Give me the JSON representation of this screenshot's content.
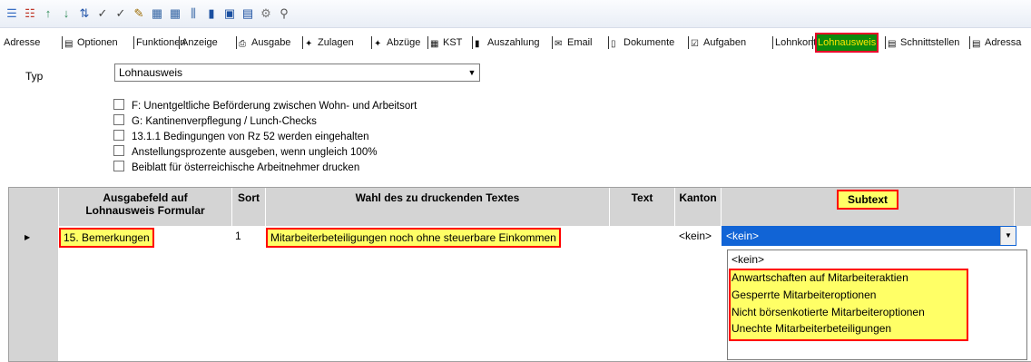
{
  "toolbar": {
    "icons": [
      "tree-expand-icon",
      "tree-collapse-icon",
      "arrow-up-icon",
      "arrow-down-icon",
      "sort-icon",
      "spellcheck-icon",
      "spellcheck-alt-icon",
      "edit-icon",
      "grid-icon",
      "grid-alt-icon",
      "insert-column-icon",
      "chart-icon",
      "save-icon",
      "report-icon",
      "settings-icon",
      "search-icon"
    ],
    "glyphs": [
      "☰",
      "☷",
      "↑",
      "↓",
      "⇅",
      "✓",
      "✓",
      "✎",
      "▦",
      "▦",
      "⫼",
      "▮",
      "▣",
      "▤",
      "⚙",
      "⚲"
    ]
  },
  "tabs": [
    {
      "label": "Adresse",
      "icon": ""
    },
    {
      "label": "Optionen",
      "icon": "▤"
    },
    {
      "label": "Funktionen",
      "icon": ""
    },
    {
      "label": "Anzeige",
      "icon": ""
    },
    {
      "label": "Ausgabe",
      "icon": "⎙"
    },
    {
      "label": "Zulagen",
      "icon": "✦"
    },
    {
      "label": "Abzüge",
      "icon": "✦"
    },
    {
      "label": "KST",
      "icon": "▦"
    },
    {
      "label": "Auszahlung",
      "icon": "▮"
    },
    {
      "label": "Email",
      "icon": "✉"
    },
    {
      "label": "Dokumente",
      "icon": "▯"
    },
    {
      "label": "Aufgaben",
      "icon": "☑"
    },
    {
      "label": "Lohnkonto",
      "icon": ""
    },
    {
      "label": "Lohnausweis",
      "icon": ""
    },
    {
      "label": "Schnittstellen",
      "icon": "▤"
    },
    {
      "label": "Adressa",
      "icon": "▤"
    }
  ],
  "typ": {
    "label": "Typ",
    "value": "Lohnausweis"
  },
  "checkboxes": [
    "F: Unentgeltliche Beförderung zwischen Wohn- und Arbeitsort",
    "G: Kantinenverpflegung / Lunch-Checks",
    "13.1.1 Bedingungen von Rz 52 werden eingehalten",
    "Anstellungsprozente ausgeben, wenn ungleich 100%",
    "Beiblatt für österreichische Arbeitnehmer drucken"
  ],
  "grid": {
    "headers": {
      "ausgabefeld_1": "Ausgabefeld auf",
      "ausgabefeld_2": "Lohnausweis Formular",
      "sort": "Sort",
      "wahl": "Wahl des zu druckenden Textes",
      "text": "Text",
      "kanton": "Kanton",
      "subtext": "Subtext"
    },
    "row": {
      "ausgabefeld": "15. Bemerkungen",
      "sort": "1",
      "wahl": "Mitarbeiterbeteiligungen noch ohne steuerbare Einkommen",
      "text": "",
      "kanton": "<kein>",
      "subtext": "<kein>"
    }
  },
  "subtext_options": [
    "<kein>",
    "Anwartschaften auf Mitarbeiteraktien",
    "Gesperrte Mitarbeiteroptionen",
    "Nicht börsenkotierte Mitarbeiteroptionen",
    "Unechte Mitarbeiterbeteiligungen"
  ],
  "colors": {
    "highlight": "#ffff66",
    "border": "#ff0000",
    "active_tab": "#0c8a0c",
    "selection": "#1164d6"
  }
}
